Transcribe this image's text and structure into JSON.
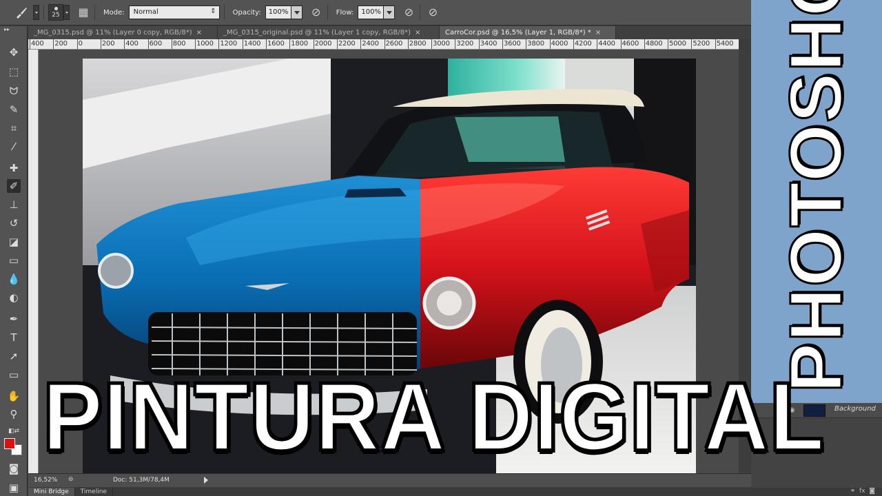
{
  "options_bar": {
    "brush_size": "25",
    "mode_label": "Mode:",
    "mode_value": "Normal",
    "opacity_label": "Opacity:",
    "opacity_value": "100%",
    "flow_label": "Flow:",
    "flow_value": "100%"
  },
  "tabs": [
    {
      "label": "_MG_0315.psd @ 11% (Layer 0 copy, RGB/8*)",
      "close": "×"
    },
    {
      "label": "_MG_0315_original.psd @ 11% (Layer 1 copy, RGB/8*)",
      "close": "×"
    },
    {
      "label": "CarroCor.psd @ 16,5% (Layer 1, RGB/8*) *",
      "close": "×"
    }
  ],
  "ruler_top": [
    "400",
    "200",
    "0",
    "200",
    "400",
    "600",
    "800",
    "1000",
    "1200",
    "1400",
    "1600",
    "1800",
    "2000",
    "2200",
    "2400",
    "2600",
    "2800",
    "3000",
    "3200",
    "3400",
    "3600",
    "3800",
    "4000",
    "4200",
    "4400",
    "4600",
    "4800",
    "5000",
    "5200",
    "5400"
  ],
  "status": {
    "zoom": "16,52%",
    "doc": "Doc: 51,3M/78,4M"
  },
  "bottom_panels": [
    "Mini Bridge",
    "Timeline"
  ],
  "overlay": {
    "title": "PINTURA DIGITAL",
    "side_title": "PHOTOSHOP"
  },
  "layers": {
    "name": "Background"
  },
  "colors": {
    "foreground": "#e20d0d",
    "background": "#ffffff",
    "car_blue": "#0a6fb5",
    "car_red": "#d4121a",
    "brand_panel": "#7ea4cc"
  },
  "icons": [
    "brush-icon",
    "brush-preset-icon",
    "brush-panel-icon",
    "airbrush-icon",
    "tablet-pressure-icon",
    "move-tool-icon",
    "marquee-tool-icon",
    "lasso-tool-icon",
    "quick-selection-tool-icon",
    "crop-tool-icon",
    "eyedropper-tool-icon",
    "healing-brush-tool-icon",
    "brush-tool-icon",
    "clone-stamp-tool-icon",
    "history-brush-tool-icon",
    "eraser-tool-icon",
    "gradient-tool-icon",
    "blur-tool-icon",
    "dodge-tool-icon",
    "pen-tool-icon",
    "type-tool-icon",
    "path-selection-tool-icon",
    "rectangle-tool-icon",
    "hand-tool-icon",
    "zoom-tool-icon",
    "quick-mask-icon",
    "screen-mode-icon"
  ]
}
